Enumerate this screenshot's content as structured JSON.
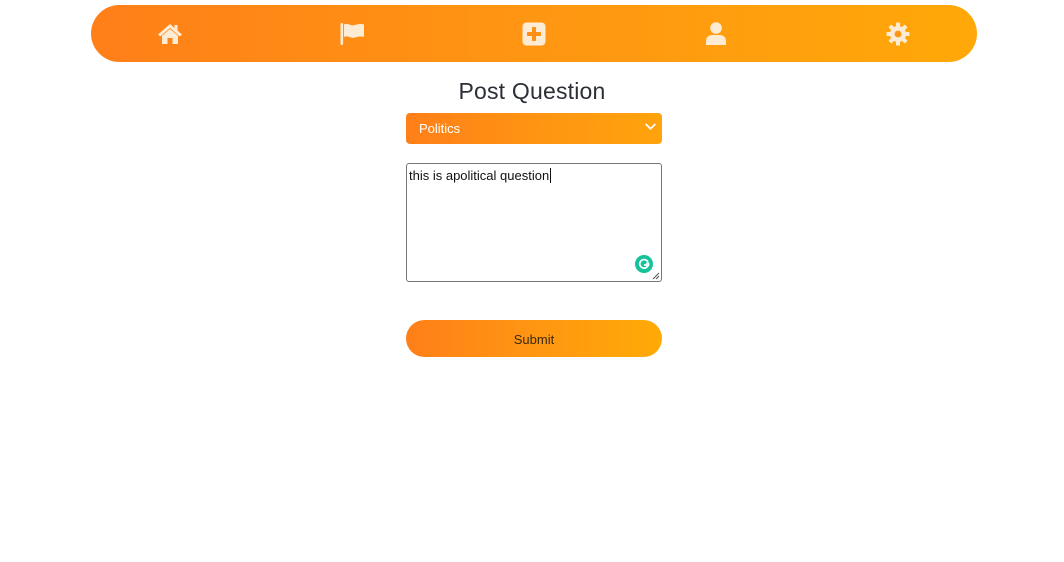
{
  "nav": {
    "items": [
      {
        "icon": "home-icon"
      },
      {
        "icon": "flag-icon"
      },
      {
        "icon": "plus-square-icon"
      },
      {
        "icon": "user-icon"
      },
      {
        "icon": "gear-icon"
      }
    ],
    "icon_color": "#fdebd3",
    "gradient": [
      "#ff7f18",
      "#ffa808"
    ]
  },
  "page": {
    "title": "Post Question"
  },
  "form": {
    "category_selected": "Politics",
    "question_value": "this is apolitical question",
    "submit_label": "Submit"
  },
  "colors": {
    "accent_start": "#ff7f18",
    "accent_end": "#ffa808",
    "grammarly": "#15c39a"
  }
}
